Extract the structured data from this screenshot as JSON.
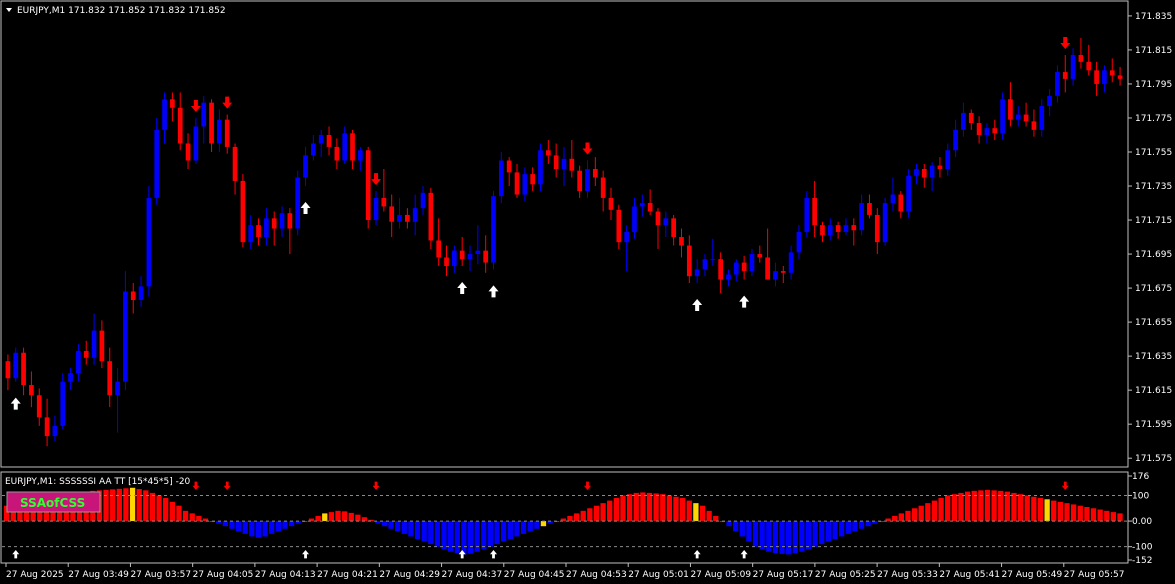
{
  "main_window": {
    "title": "EURJPY,M1  171.832 171.852 171.832 171.852",
    "price_labels": [
      "171.835",
      "171.815",
      "171.795",
      "171.775",
      "171.755",
      "171.735",
      "171.715",
      "171.695",
      "171.675",
      "171.655",
      "171.635",
      "171.615",
      "171.595",
      "171.575"
    ]
  },
  "indicator_window": {
    "title": "EURJPY,M1: SSSSSSI AA TT [15*45*5]  -20",
    "badge_label": "SSAofCSS",
    "scale_labels": [
      "176",
      "100",
      "0.00",
      "-100",
      "-152"
    ]
  },
  "time_labels": [
    "27 Aug 2025",
    "27 Aug 03:49",
    "27 Aug 03:57",
    "27 Aug 04:05",
    "27 Aug 04:13",
    "27 Aug 04:21",
    "27 Aug 04:29",
    "27 Aug 04:37",
    "27 Aug 04:45",
    "27 Aug 04:53",
    "27 Aug 05:01",
    "27 Aug 05:09",
    "27 Aug 05:17",
    "27 Aug 05:25",
    "27 Aug 05:33",
    "27 Aug 05:41",
    "27 Aug 05:49",
    "27 Aug 05:57"
  ],
  "colors": {
    "bull": "#0000ff",
    "bear": "#ff0000",
    "neutral": "#ffd700",
    "up_arrow": "#ffffff",
    "down_arrow": "#ff0000",
    "badge_bg": "#c8157a",
    "badge_text": "#33ff33"
  },
  "chart_data": {
    "type": "candlestick",
    "symbol": "EURJPY",
    "timeframe": "M1",
    "y_range": [
      171.571,
      171.842
    ],
    "bars": [
      {
        "o": 171.632,
        "h": 171.636,
        "l": 171.615,
        "c": 171.622
      },
      {
        "o": 171.622,
        "h": 171.64,
        "l": 171.62,
        "c": 171.637
      },
      {
        "o": 171.637,
        "h": 171.64,
        "l": 171.612,
        "c": 171.618
      },
      {
        "o": 171.618,
        "h": 171.626,
        "l": 171.605,
        "c": 171.612
      },
      {
        "o": 171.612,
        "h": 171.616,
        "l": 171.594,
        "c": 171.599
      },
      {
        "o": 171.599,
        "h": 171.61,
        "l": 171.582,
        "c": 171.588
      },
      {
        "o": 171.588,
        "h": 171.6,
        "l": 171.585,
        "c": 171.594
      },
      {
        "o": 171.594,
        "h": 171.625,
        "l": 171.592,
        "c": 171.62
      },
      {
        "o": 171.62,
        "h": 171.628,
        "l": 171.615,
        "c": 171.625
      },
      {
        "o": 171.625,
        "h": 171.642,
        "l": 171.62,
        "c": 171.638
      },
      {
        "o": 171.638,
        "h": 171.644,
        "l": 171.63,
        "c": 171.634
      },
      {
        "o": 171.634,
        "h": 171.66,
        "l": 171.63,
        "c": 171.65
      },
      {
        "o": 171.65,
        "h": 171.656,
        "l": 171.628,
        "c": 171.632
      },
      {
        "o": 171.632,
        "h": 171.64,
        "l": 171.605,
        "c": 171.612
      },
      {
        "o": 171.612,
        "h": 171.628,
        "l": 171.59,
        "c": 171.62
      },
      {
        "o": 171.62,
        "h": 171.685,
        "l": 171.615,
        "c": 171.673
      },
      {
        "o": 171.673,
        "h": 171.678,
        "l": 171.66,
        "c": 171.668
      },
      {
        "o": 171.668,
        "h": 171.682,
        "l": 171.664,
        "c": 171.676
      },
      {
        "o": 171.676,
        "h": 171.735,
        "l": 171.67,
        "c": 171.728
      },
      {
        "o": 171.728,
        "h": 171.775,
        "l": 171.724,
        "c": 171.768
      },
      {
        "o": 171.768,
        "h": 171.79,
        "l": 171.76,
        "c": 171.786
      },
      {
        "o": 171.786,
        "h": 171.79,
        "l": 171.773,
        "c": 171.781
      },
      {
        "o": 171.781,
        "h": 171.79,
        "l": 171.756,
        "c": 171.76
      },
      {
        "o": 171.76,
        "h": 171.766,
        "l": 171.745,
        "c": 171.75
      },
      {
        "o": 171.75,
        "h": 171.775,
        "l": 171.748,
        "c": 171.77
      },
      {
        "o": 171.77,
        "h": 171.788,
        "l": 171.76,
        "c": 171.784
      },
      {
        "o": 171.784,
        "h": 171.786,
        "l": 171.755,
        "c": 171.76
      },
      {
        "o": 171.76,
        "h": 171.78,
        "l": 171.755,
        "c": 171.774
      },
      {
        "o": 171.774,
        "h": 171.777,
        "l": 171.754,
        "c": 171.758
      },
      {
        "o": 171.758,
        "h": 171.76,
        "l": 171.73,
        "c": 171.738
      },
      {
        "o": 171.738,
        "h": 171.742,
        "l": 171.699,
        "c": 171.702
      },
      {
        "o": 171.702,
        "h": 171.718,
        "l": 171.698,
        "c": 171.712
      },
      {
        "o": 171.712,
        "h": 171.716,
        "l": 171.7,
        "c": 171.705
      },
      {
        "o": 171.705,
        "h": 171.722,
        "l": 171.7,
        "c": 171.716
      },
      {
        "o": 171.716,
        "h": 171.72,
        "l": 171.7,
        "c": 171.71
      },
      {
        "o": 171.71,
        "h": 171.723,
        "l": 171.705,
        "c": 171.719
      },
      {
        "o": 171.719,
        "h": 171.722,
        "l": 171.695,
        "c": 171.71
      },
      {
        "o": 171.71,
        "h": 171.744,
        "l": 171.706,
        "c": 171.74
      },
      {
        "o": 171.74,
        "h": 171.758,
        "l": 171.735,
        "c": 171.753
      },
      {
        "o": 171.753,
        "h": 171.765,
        "l": 171.75,
        "c": 171.76
      },
      {
        "o": 171.76,
        "h": 171.768,
        "l": 171.752,
        "c": 171.765
      },
      {
        "o": 171.765,
        "h": 171.77,
        "l": 171.753,
        "c": 171.758
      },
      {
        "o": 171.758,
        "h": 171.763,
        "l": 171.745,
        "c": 171.75
      },
      {
        "o": 171.75,
        "h": 171.77,
        "l": 171.748,
        "c": 171.766
      },
      {
        "o": 171.766,
        "h": 171.768,
        "l": 171.745,
        "c": 171.75
      },
      {
        "o": 171.75,
        "h": 171.758,
        "l": 171.744,
        "c": 171.756
      },
      {
        "o": 171.756,
        "h": 171.758,
        "l": 171.71,
        "c": 171.715
      },
      {
        "o": 171.715,
        "h": 171.732,
        "l": 171.712,
        "c": 171.728
      },
      {
        "o": 171.728,
        "h": 171.745,
        "l": 171.72,
        "c": 171.723
      },
      {
        "o": 171.723,
        "h": 171.73,
        "l": 171.705,
        "c": 171.714
      },
      {
        "o": 171.714,
        "h": 171.728,
        "l": 171.71,
        "c": 171.718
      },
      {
        "o": 171.718,
        "h": 171.722,
        "l": 171.71,
        "c": 171.714
      },
      {
        "o": 171.714,
        "h": 171.73,
        "l": 171.706,
        "c": 171.722
      },
      {
        "o": 171.722,
        "h": 171.735,
        "l": 171.718,
        "c": 171.731
      },
      {
        "o": 171.731,
        "h": 171.734,
        "l": 171.698,
        "c": 171.703
      },
      {
        "o": 171.703,
        "h": 171.716,
        "l": 171.688,
        "c": 171.693
      },
      {
        "o": 171.693,
        "h": 171.7,
        "l": 171.682,
        "c": 171.688
      },
      {
        "o": 171.688,
        "h": 171.7,
        "l": 171.684,
        "c": 171.697
      },
      {
        "o": 171.697,
        "h": 171.705,
        "l": 171.688,
        "c": 171.692
      },
      {
        "o": 171.692,
        "h": 171.7,
        "l": 171.685,
        "c": 171.695
      },
      {
        "o": 171.695,
        "h": 171.712,
        "l": 171.689,
        "c": 171.697
      },
      {
        "o": 171.697,
        "h": 171.706,
        "l": 171.684,
        "c": 171.69
      },
      {
        "o": 171.69,
        "h": 171.732,
        "l": 171.686,
        "c": 171.729
      },
      {
        "o": 171.729,
        "h": 171.755,
        "l": 171.725,
        "c": 171.75
      },
      {
        "o": 171.75,
        "h": 171.752,
        "l": 171.735,
        "c": 171.743
      },
      {
        "o": 171.743,
        "h": 171.748,
        "l": 171.728,
        "c": 171.73
      },
      {
        "o": 171.73,
        "h": 171.746,
        "l": 171.726,
        "c": 171.742
      },
      {
        "o": 171.742,
        "h": 171.746,
        "l": 171.732,
        "c": 171.736
      },
      {
        "o": 171.736,
        "h": 171.76,
        "l": 171.732,
        "c": 171.756
      },
      {
        "o": 171.756,
        "h": 171.762,
        "l": 171.748,
        "c": 171.753
      },
      {
        "o": 171.753,
        "h": 171.76,
        "l": 171.74,
        "c": 171.745
      },
      {
        "o": 171.745,
        "h": 171.758,
        "l": 171.735,
        "c": 171.751
      },
      {
        "o": 171.751,
        "h": 171.762,
        "l": 171.74,
        "c": 171.744
      },
      {
        "o": 171.744,
        "h": 171.747,
        "l": 171.728,
        "c": 171.732
      },
      {
        "o": 171.732,
        "h": 171.75,
        "l": 171.728,
        "c": 171.745
      },
      {
        "o": 171.745,
        "h": 171.752,
        "l": 171.735,
        "c": 171.74
      },
      {
        "o": 171.74,
        "h": 171.744,
        "l": 171.72,
        "c": 171.728
      },
      {
        "o": 171.728,
        "h": 171.734,
        "l": 171.715,
        "c": 171.721
      },
      {
        "o": 171.721,
        "h": 171.724,
        "l": 171.698,
        "c": 171.702
      },
      {
        "o": 171.702,
        "h": 171.712,
        "l": 171.685,
        "c": 171.708
      },
      {
        "o": 171.708,
        "h": 171.728,
        "l": 171.704,
        "c": 171.723
      },
      {
        "o": 171.723,
        "h": 171.73,
        "l": 171.717,
        "c": 171.725
      },
      {
        "o": 171.725,
        "h": 171.733,
        "l": 171.718,
        "c": 171.72
      },
      {
        "o": 171.72,
        "h": 171.722,
        "l": 171.698,
        "c": 171.712
      },
      {
        "o": 171.712,
        "h": 171.72,
        "l": 171.705,
        "c": 171.716
      },
      {
        "o": 171.716,
        "h": 171.718,
        "l": 171.7,
        "c": 171.705
      },
      {
        "o": 171.705,
        "h": 171.71,
        "l": 171.693,
        "c": 171.7
      },
      {
        "o": 171.7,
        "h": 171.706,
        "l": 171.678,
        "c": 171.682
      },
      {
        "o": 171.682,
        "h": 171.692,
        "l": 171.678,
        "c": 171.686
      },
      {
        "o": 171.686,
        "h": 171.695,
        "l": 171.682,
        "c": 171.692
      },
      {
        "o": 171.692,
        "h": 171.704,
        "l": 171.688,
        "c": 171.692
      },
      {
        "o": 171.692,
        "h": 171.696,
        "l": 171.672,
        "c": 171.68
      },
      {
        "o": 171.68,
        "h": 171.686,
        "l": 171.676,
        "c": 171.683
      },
      {
        "o": 171.683,
        "h": 171.692,
        "l": 171.679,
        "c": 171.69
      },
      {
        "o": 171.69,
        "h": 171.694,
        "l": 171.68,
        "c": 171.685
      },
      {
        "o": 171.685,
        "h": 171.698,
        "l": 171.682,
        "c": 171.695
      },
      {
        "o": 171.695,
        "h": 171.7,
        "l": 171.69,
        "c": 171.693
      },
      {
        "o": 171.693,
        "h": 171.71,
        "l": 171.68,
        "c": 171.68
      },
      {
        "o": 171.68,
        "h": 171.69,
        "l": 171.676,
        "c": 171.685
      },
      {
        "o": 171.685,
        "h": 171.688,
        "l": 171.678,
        "c": 171.684
      },
      {
        "o": 171.684,
        "h": 171.7,
        "l": 171.68,
        "c": 171.696
      },
      {
        "o": 171.696,
        "h": 171.712,
        "l": 171.692,
        "c": 171.708
      },
      {
        "o": 171.708,
        "h": 171.732,
        "l": 171.705,
        "c": 171.728
      },
      {
        "o": 171.728,
        "h": 171.738,
        "l": 171.705,
        "c": 171.712
      },
      {
        "o": 171.712,
        "h": 171.714,
        "l": 171.702,
        "c": 171.706
      },
      {
        "o": 171.706,
        "h": 171.716,
        "l": 171.703,
        "c": 171.712
      },
      {
        "o": 171.712,
        "h": 171.714,
        "l": 171.704,
        "c": 171.708
      },
      {
        "o": 171.708,
        "h": 171.716,
        "l": 171.706,
        "c": 171.712
      },
      {
        "o": 171.712,
        "h": 171.716,
        "l": 171.7,
        "c": 171.709
      },
      {
        "o": 171.709,
        "h": 171.73,
        "l": 171.706,
        "c": 171.725
      },
      {
        "o": 171.725,
        "h": 171.73,
        "l": 171.716,
        "c": 171.718
      },
      {
        "o": 171.718,
        "h": 171.722,
        "l": 171.695,
        "c": 171.702
      },
      {
        "o": 171.702,
        "h": 171.728,
        "l": 171.7,
        "c": 171.725
      },
      {
        "o": 171.725,
        "h": 171.74,
        "l": 171.72,
        "c": 171.73
      },
      {
        "o": 171.73,
        "h": 171.732,
        "l": 171.716,
        "c": 171.72
      },
      {
        "o": 171.72,
        "h": 171.745,
        "l": 171.716,
        "c": 171.741
      },
      {
        "o": 171.741,
        "h": 171.748,
        "l": 171.736,
        "c": 171.745
      },
      {
        "o": 171.745,
        "h": 171.748,
        "l": 171.734,
        "c": 171.74
      },
      {
        "o": 171.74,
        "h": 171.749,
        "l": 171.732,
        "c": 171.747
      },
      {
        "o": 171.747,
        "h": 171.752,
        "l": 171.74,
        "c": 171.745
      },
      {
        "o": 171.745,
        "h": 171.76,
        "l": 171.741,
        "c": 171.756
      },
      {
        "o": 171.756,
        "h": 171.774,
        "l": 171.752,
        "c": 171.768
      },
      {
        "o": 171.768,
        "h": 171.784,
        "l": 171.764,
        "c": 171.778
      },
      {
        "o": 171.778,
        "h": 171.78,
        "l": 171.768,
        "c": 171.772
      },
      {
        "o": 171.772,
        "h": 171.776,
        "l": 171.76,
        "c": 171.765
      },
      {
        "o": 171.765,
        "h": 171.772,
        "l": 171.76,
        "c": 171.769
      },
      {
        "o": 171.769,
        "h": 171.774,
        "l": 171.762,
        "c": 171.766
      },
      {
        "o": 171.766,
        "h": 171.79,
        "l": 171.762,
        "c": 171.786
      },
      {
        "o": 171.786,
        "h": 171.796,
        "l": 171.77,
        "c": 171.774
      },
      {
        "o": 171.774,
        "h": 171.782,
        "l": 171.77,
        "c": 171.777
      },
      {
        "o": 171.777,
        "h": 171.784,
        "l": 171.77,
        "c": 171.773
      },
      {
        "o": 171.773,
        "h": 171.78,
        "l": 171.764,
        "c": 171.768
      },
      {
        "o": 171.768,
        "h": 171.786,
        "l": 171.764,
        "c": 171.782
      },
      {
        "o": 171.782,
        "h": 171.792,
        "l": 171.776,
        "c": 171.788
      },
      {
        "o": 171.788,
        "h": 171.806,
        "l": 171.784,
        "c": 171.802
      },
      {
        "o": 171.802,
        "h": 171.812,
        "l": 171.79,
        "c": 171.798
      },
      {
        "o": 171.798,
        "h": 171.816,
        "l": 171.794,
        "c": 171.812
      },
      {
        "o": 171.812,
        "h": 171.822,
        "l": 171.804,
        "c": 171.808
      },
      {
        "o": 171.808,
        "h": 171.818,
        "l": 171.8,
        "c": 171.803
      },
      {
        "o": 171.803,
        "h": 171.808,
        "l": 171.788,
        "c": 171.795
      },
      {
        "o": 171.795,
        "h": 171.806,
        "l": 171.79,
        "c": 171.803
      },
      {
        "o": 171.803,
        "h": 171.81,
        "l": 171.796,
        "c": 171.8
      },
      {
        "o": 171.8,
        "h": 171.805,
        "l": 171.794,
        "c": 171.798
      }
    ],
    "up_arrows_at_bar": [
      1,
      38,
      58,
      62,
      88,
      94
    ],
    "down_arrows_at_bar": [
      24,
      28,
      47,
      74,
      135
    ],
    "indicator": {
      "name": "SSSSSSI AA TT",
      "y_range": [
        -152,
        176
      ],
      "levels": [
        100,
        0,
        -100
      ],
      "values": [
        60,
        70,
        75,
        85,
        90,
        92,
        95,
        100,
        105,
        108,
        110,
        112,
        115,
        118,
        120,
        122,
        124,
        126,
        128,
        130,
        125,
        120,
        110,
        100,
        90,
        75,
        60,
        40,
        30,
        20,
        10,
        0,
        -10,
        -20,
        -30,
        -40,
        -50,
        -60,
        -65,
        -60,
        -50,
        -40,
        -30,
        -20,
        -10,
        0,
        10,
        20,
        30,
        35,
        40,
        38,
        32,
        25,
        15,
        5,
        -10,
        -20,
        -30,
        -40,
        -50,
        -60,
        -70,
        -80,
        -90,
        -100,
        -110,
        -120,
        -125,
        -130,
        -128,
        -120,
        -110,
        -100,
        -90,
        -80,
        -70,
        -60,
        -50,
        -40,
        -30,
        -20,
        -10,
        0,
        10,
        20,
        30,
        40,
        50,
        60,
        70,
        80,
        90,
        100,
        105,
        110,
        112,
        110,
        108,
        105,
        100,
        95,
        90,
        80,
        70,
        60,
        40,
        20,
        0,
        -20,
        -40,
        -60,
        -80,
        -100,
        -110,
        -120,
        -125,
        -128,
        -130,
        -125,
        -120,
        -110,
        -100,
        -90,
        -80,
        -70,
        -60,
        -50,
        -40,
        -30,
        -20,
        -10,
        0,
        10,
        20,
        30,
        40,
        50,
        60,
        70,
        80,
        90,
        100,
        105,
        110,
        115,
        118,
        120,
        122,
        120,
        118,
        115,
        110,
        105,
        100,
        95,
        90,
        85,
        80,
        75,
        70,
        65,
        60,
        55,
        50,
        45,
        40,
        35,
        30
      ],
      "yellow_at": [
        19,
        48,
        81,
        104,
        157
      ]
    }
  }
}
